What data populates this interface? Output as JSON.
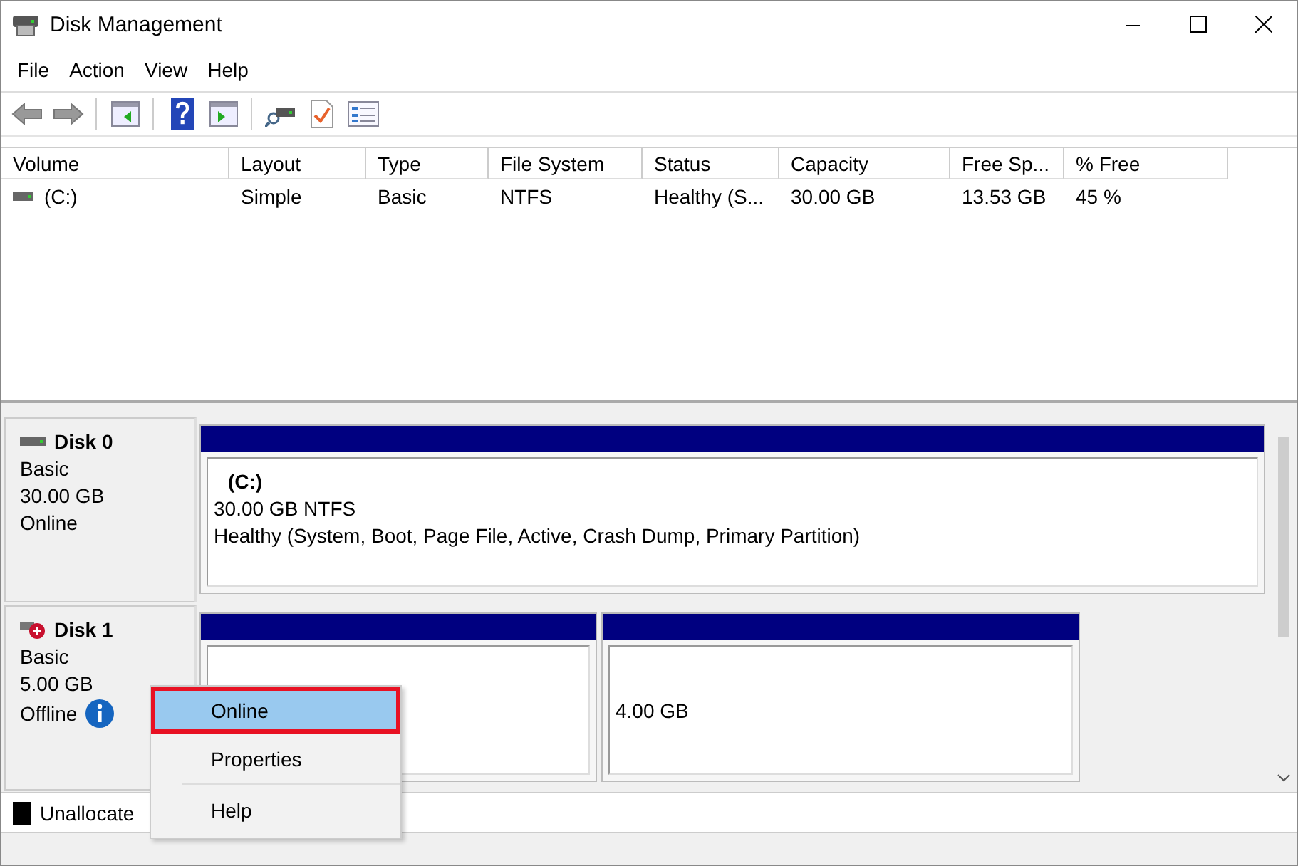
{
  "window": {
    "title": "Disk Management"
  },
  "menu": [
    "File",
    "Action",
    "View",
    "Help"
  ],
  "toolbar": [
    {
      "kind": "back"
    },
    {
      "kind": "forward"
    },
    {
      "kind": "sep"
    },
    {
      "kind": "tree"
    },
    {
      "kind": "sep"
    },
    {
      "kind": "help"
    },
    {
      "kind": "pane"
    },
    {
      "kind": "sep"
    },
    {
      "kind": "connect"
    },
    {
      "kind": "check"
    },
    {
      "kind": "list"
    }
  ],
  "volume_table": {
    "columns": [
      "Volume",
      "Layout",
      "Type",
      "File System",
      "Status",
      "Capacity",
      "Free Sp...",
      "% Free"
    ],
    "rows": [
      {
        "cells": [
          "(C:)",
          "Simple",
          "Basic",
          "NTFS",
          "Healthy (S...",
          "30.00 GB",
          "13.53 GB",
          "45 %"
        ]
      }
    ]
  },
  "disks": [
    {
      "name": "Disk 0",
      "type": "Basic",
      "size": "30.00 GB",
      "status": "Online",
      "offline": false,
      "partitions": [
        {
          "kind": "primary",
          "name": "(C:)",
          "size": "30.00 GB NTFS",
          "health": "Healthy (System, Boot, Page File, Active, Crash Dump, Primary Partition)"
        }
      ]
    },
    {
      "name": "Disk 1",
      "type": "Basic",
      "size": "5.00 GB",
      "status": "Offline",
      "offline": true,
      "partitions": [
        {
          "kind": "primary"
        },
        {
          "kind": "primary",
          "size": "4.00 GB"
        }
      ]
    }
  ],
  "legend": [
    {
      "label": "Unallocate",
      "color": "#000000"
    }
  ],
  "context_menu": [
    {
      "label": "Online",
      "selected": true,
      "separator_before": false
    },
    {
      "label": "Properties",
      "selected": false,
      "separator_before": false
    },
    {
      "label": "Help",
      "selected": false,
      "separator_before": true
    }
  ]
}
